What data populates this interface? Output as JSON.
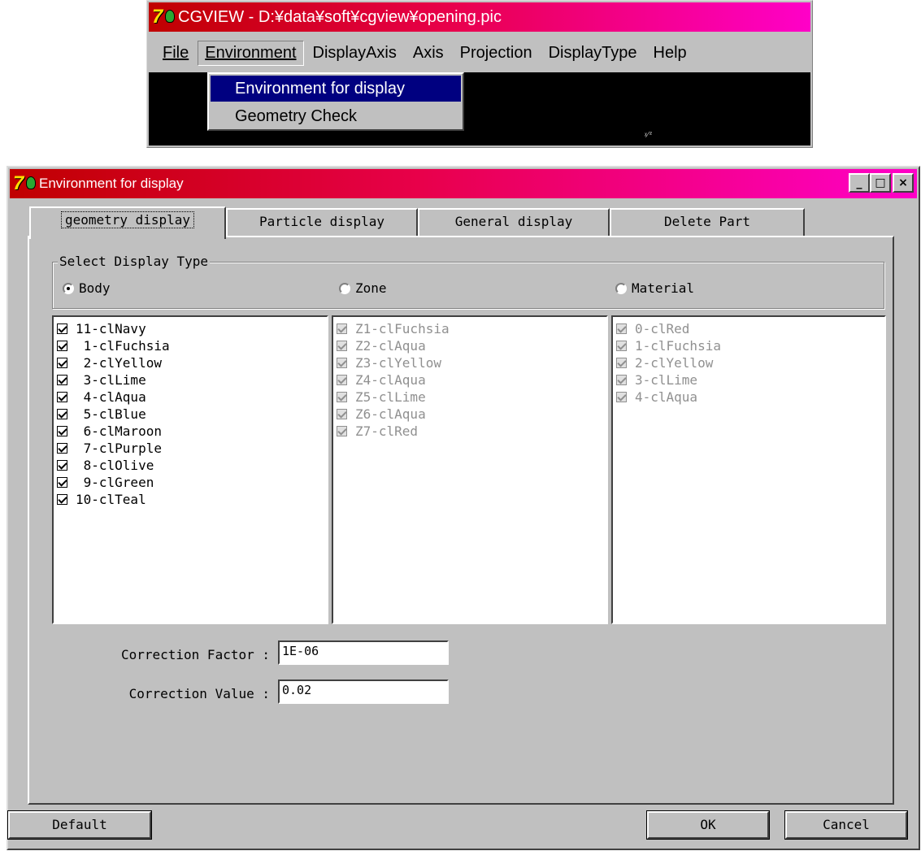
{
  "menu_window": {
    "title": "CGVIEW - D:¥data¥soft¥cgview¥opening.pic",
    "menus": {
      "file": "File",
      "environment": "Environment",
      "display_axis": "DisplayAxis",
      "axis": "Axis",
      "projection": "Projection",
      "display_type": "DisplayType",
      "help": "Help"
    },
    "dropdown": {
      "environment_for_display": "Environment for display",
      "geometry_check": "Geometry Check"
    }
  },
  "dialog": {
    "title": "Environment for display",
    "window_buttons": {
      "minimize": "_",
      "maximize": "□",
      "close": "×"
    },
    "tabs": {
      "geometry": "geometry display",
      "particle": "Particle display",
      "general": "General display",
      "delete": "Delete Part"
    },
    "group": {
      "legend": "Select Display Type",
      "body": "Body",
      "zone": "Zone",
      "material": "Material",
      "selected": "Body"
    },
    "body_list": [
      "11-clNavy",
      " 1-clFuchsia",
      " 2-clYellow",
      " 3-clLime",
      " 4-clAqua",
      " 5-clBlue",
      " 6-clMaroon",
      " 7-clPurple",
      " 8-clOlive",
      " 9-clGreen",
      "10-clTeal"
    ],
    "zone_list": [
      "Z1-clFuchsia",
      "Z2-clAqua",
      "Z3-clYellow",
      "Z4-clAqua",
      "Z5-clLime",
      "Z6-clAqua",
      "Z7-clRed"
    ],
    "material_list": [
      "0-clRed",
      "1-clFuchsia",
      "2-clYellow",
      "3-clLime",
      "4-clAqua"
    ],
    "correction_factor": {
      "label": "Correction Factor :",
      "value": "1E-06"
    },
    "correction_value": {
      "label": "Correction Value :",
      "value": "0.02"
    },
    "buttons": {
      "default": "Default",
      "ok": "OK",
      "cancel": "Cancel"
    }
  }
}
